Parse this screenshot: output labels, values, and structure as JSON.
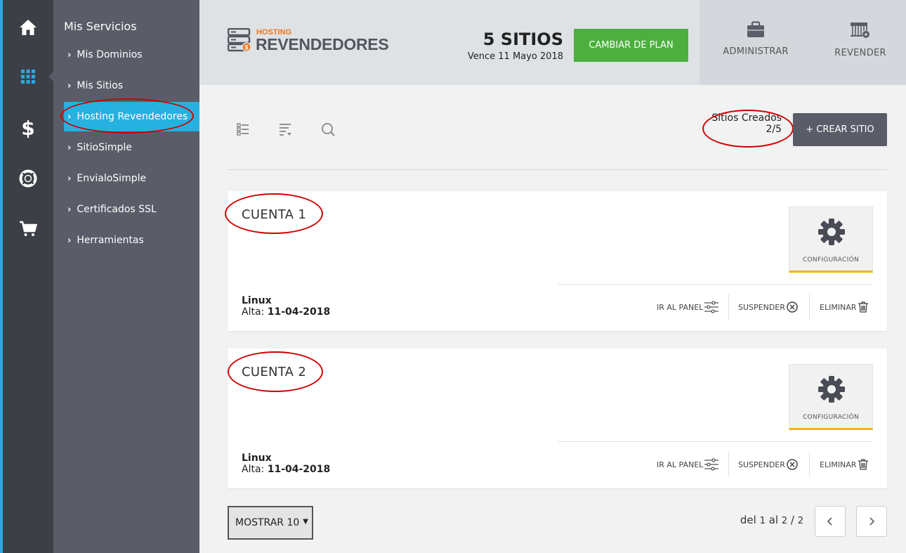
{
  "rail": {
    "items": [
      {
        "icon": "home-icon"
      },
      {
        "icon": "apps-grid-icon"
      },
      {
        "icon": "dollar-icon",
        "glyph": "$"
      },
      {
        "icon": "lifebuoy-icon"
      },
      {
        "icon": "cart-icon"
      }
    ]
  },
  "submenu": {
    "title": "Mis Servicios",
    "items": [
      {
        "label": "Mis Dominios"
      },
      {
        "label": "Mis Sitios"
      },
      {
        "label": "Hosting Revendedores"
      },
      {
        "label": "SitioSimple"
      },
      {
        "label": "EnvialoSimple"
      },
      {
        "label": "Certificados SSL"
      },
      {
        "label": "Herramientas"
      }
    ]
  },
  "header": {
    "logo_small": "HOSTING",
    "logo_big": "REVENDEDORES",
    "plan_sites": "5 SITIOS",
    "plan_expiry": "Vence 11 Mayo 2018",
    "change_plan": "CAMBIAR DE PLAN",
    "administrar": "ADMINISTRAR",
    "revender": "REVENDER"
  },
  "toolbar": {
    "sites_created_label": "Sitios Creados",
    "sites_created_value": "2/5",
    "create_button": "+ CREAR SITIO"
  },
  "accounts": [
    {
      "title": "CUENTA 1",
      "config_label": "CONFIGURACIÓN",
      "os": "Linux",
      "alta_label": "Alta:",
      "alta_date": "11-04-2018",
      "panel": "IR AL PANEL",
      "suspend": "SUSPENDER",
      "delete": "ELIMINAR"
    },
    {
      "title": "CUENTA 2",
      "config_label": "CONFIGURACIÓN",
      "os": "Linux",
      "alta_label": "Alta:",
      "alta_date": "11-04-2018",
      "panel": "IR AL PANEL",
      "suspend": "SUSPENDER",
      "delete": "ELIMINAR"
    }
  ],
  "footer": {
    "show_label": "MOSTRAR 10",
    "pager_del": "del",
    "pager_from": "1",
    "pager_al": "al",
    "pager_to": "2",
    "pager_sep": "/",
    "pager_total": "2"
  },
  "colors": {
    "rail": "#3d3f46",
    "submenu": "#5a5d68",
    "active": "#26b1e0",
    "green": "#4caf3e",
    "logo_orange": "#f0761d",
    "config_underline": "#f2b705",
    "annotation_red": "#d00000"
  }
}
